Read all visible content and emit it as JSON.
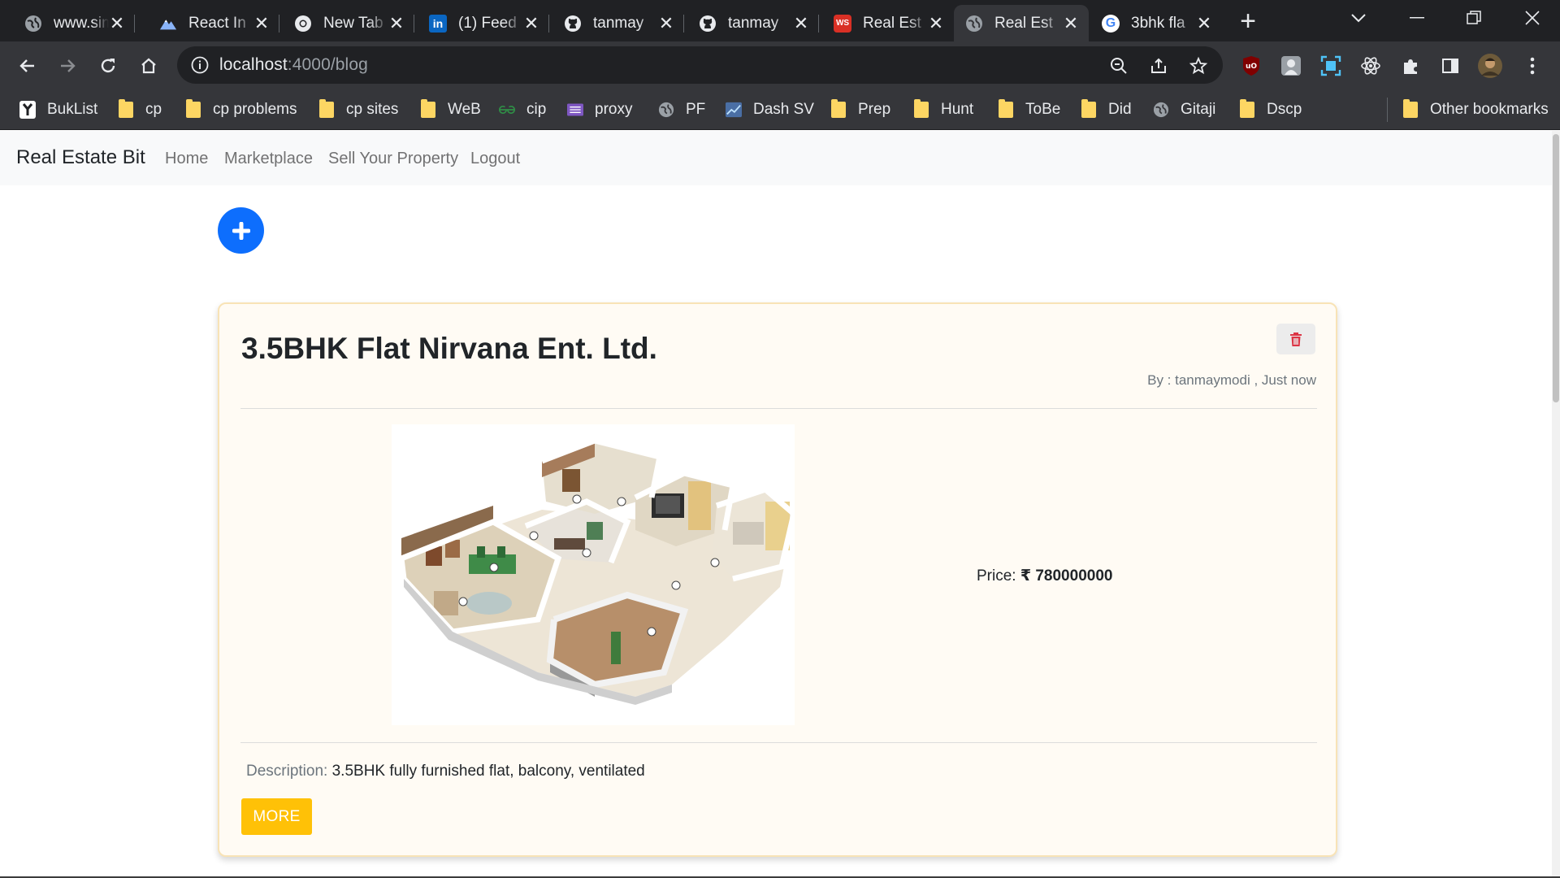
{
  "browser": {
    "tabs": [
      {
        "label": "www.sim",
        "icon": "globe-icon"
      },
      {
        "label": "React In",
        "icon": "mountain-icon"
      },
      {
        "label": "New Tab",
        "icon": "chrome-icon"
      },
      {
        "label": "(1) Feed",
        "icon": "linkedin-icon"
      },
      {
        "label": "tanmay",
        "icon": "github-icon"
      },
      {
        "label": "tanmay",
        "icon": "github-icon"
      },
      {
        "label": "Real Est",
        "icon": "ws-icon"
      },
      {
        "label": "Real Est",
        "icon": "globe-icon"
      },
      {
        "label": "3bhk fla",
        "icon": "google-icon"
      }
    ],
    "url": {
      "host": "localhost",
      "path": ":4000/blog"
    },
    "bookmarks": [
      {
        "label": "BukList",
        "icon": "app-icon"
      },
      {
        "label": "cp",
        "icon": "folder-icon"
      },
      {
        "label": "cp problems",
        "icon": "folder-icon"
      },
      {
        "label": "cp sites",
        "icon": "folder-icon"
      },
      {
        "label": "WeB",
        "icon": "folder-icon"
      },
      {
        "label": "cip",
        "icon": "gfg-icon"
      },
      {
        "label": "proxy",
        "icon": "list-icon"
      },
      {
        "label": "PF",
        "icon": "globe-icon"
      },
      {
        "label": "Dash SV",
        "icon": "chart-icon"
      },
      {
        "label": "Prep",
        "icon": "folder-icon"
      },
      {
        "label": "Hunt",
        "icon": "folder-icon"
      },
      {
        "label": "ToBe",
        "icon": "folder-icon"
      },
      {
        "label": "Did",
        "icon": "folder-icon"
      },
      {
        "label": "Gitaji",
        "icon": "globe-icon"
      },
      {
        "label": "Dscp",
        "icon": "folder-icon"
      }
    ],
    "other_bookmarks": "Other bookmarks"
  },
  "app": {
    "brand": "Real Estate Bit",
    "nav": [
      "Home",
      "Marketplace",
      "Sell Your Property",
      "Logout"
    ],
    "add_button_icon": "plus-icon"
  },
  "listing": {
    "title": "3.5BHK Flat Nirvana Ent. Ltd.",
    "byline": "By : tanmaymodi , Just now",
    "price_label": "Price:",
    "price_value": "₹ 780000000",
    "description_label": "Description:",
    "description": "3.5BHK fully furnished flat, balcony, ventilated",
    "more_label": "MORE"
  },
  "colors": {
    "primary": "#0d6efd",
    "warning": "#ffc107",
    "danger": "#dc3545",
    "card_bg": "#fffbf4",
    "card_border": "#f8e3b6"
  }
}
